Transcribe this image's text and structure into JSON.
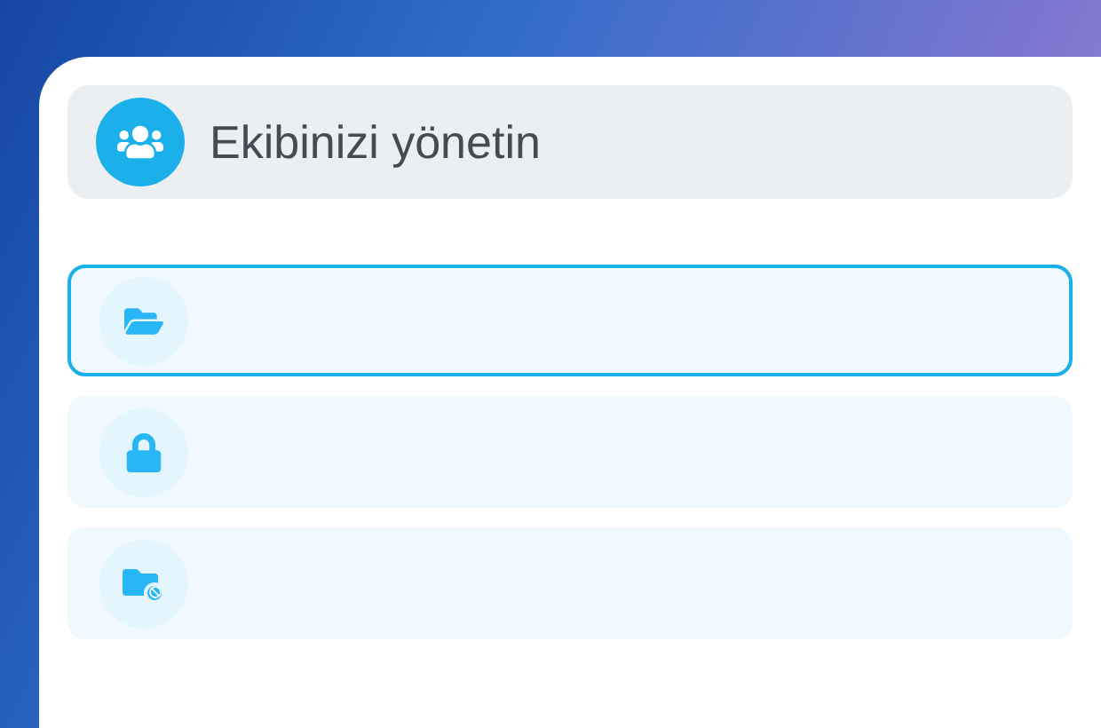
{
  "header": {
    "title": "Ekibinizi yönetin"
  },
  "items": [
    {
      "kind": "folder-open",
      "selected": true
    },
    {
      "kind": "lock",
      "selected": false
    },
    {
      "kind": "folder-blocked",
      "selected": false
    }
  ]
}
